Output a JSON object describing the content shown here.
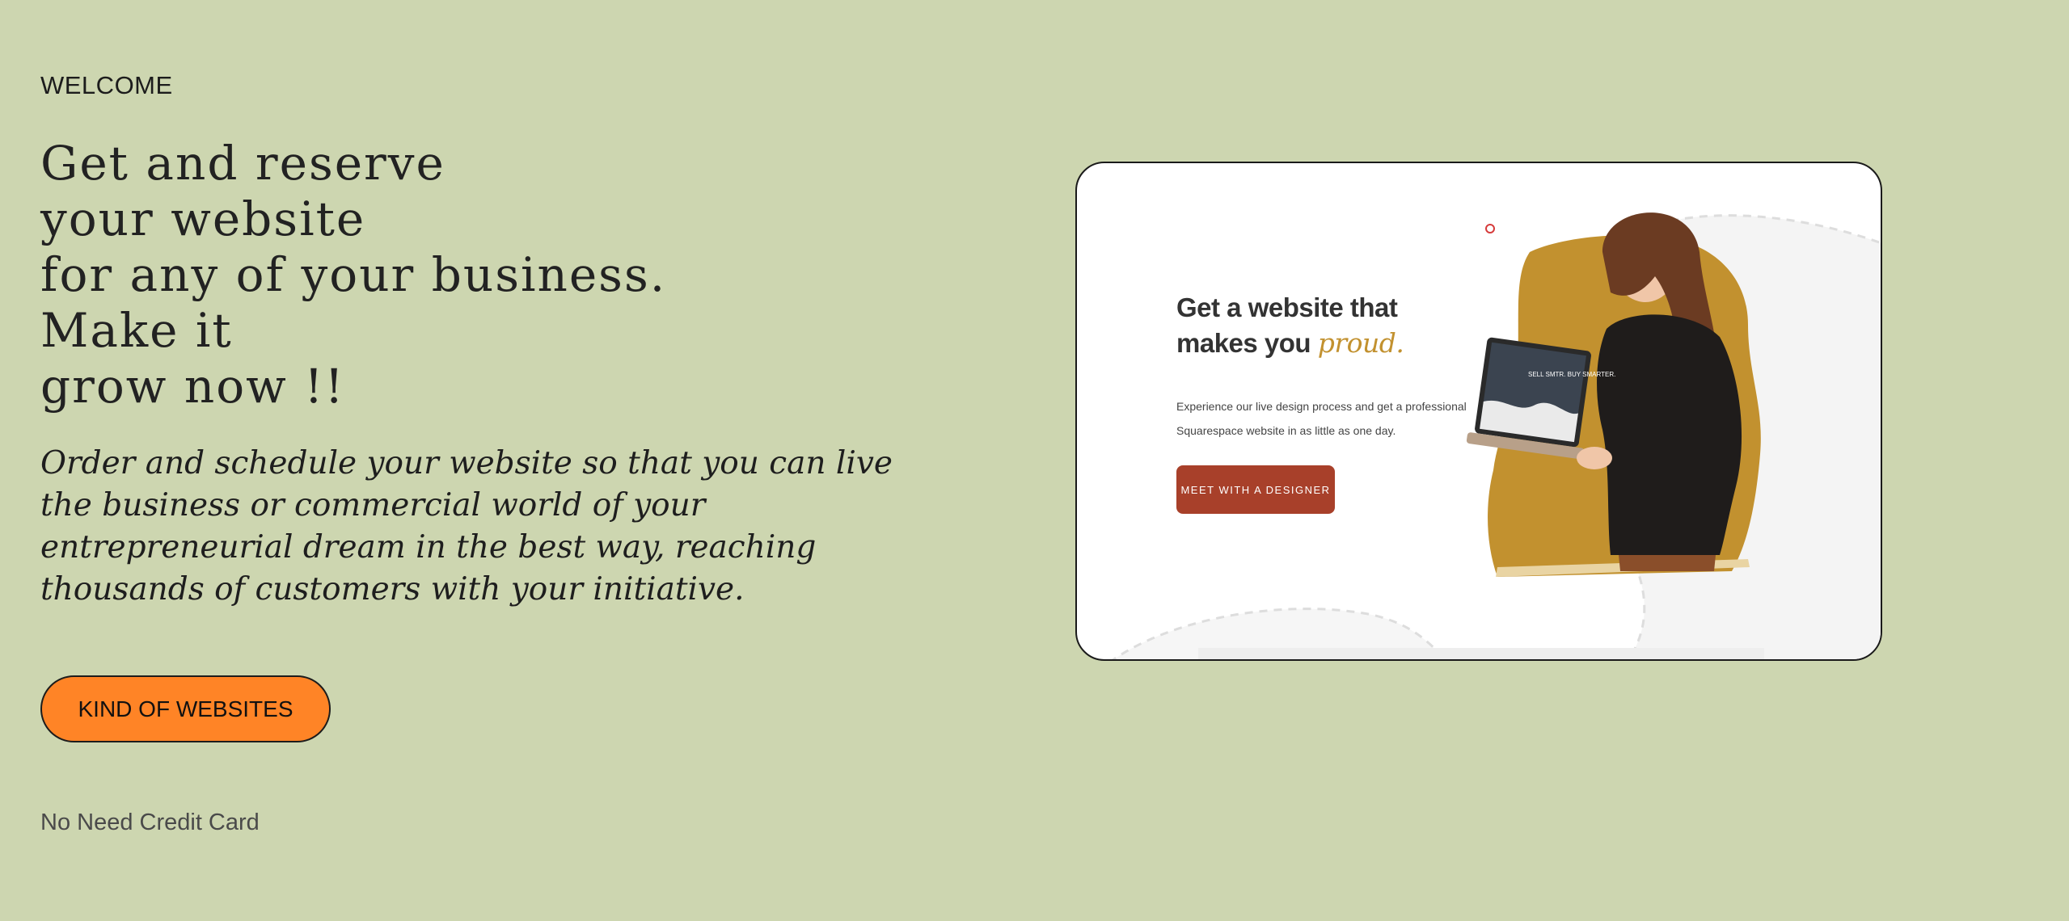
{
  "hero": {
    "eyebrow": "WELCOME",
    "headline_lines": [
      "Get and reserve",
      "your website",
      "for any of your business.",
      "Make it",
      "grow now !!"
    ],
    "lead": "Order and schedule your website so that you can live the business or commercial world of your entrepreneurial dream in the best way, reaching thousands of customers with your initiative.",
    "cta_label": "KIND OF WEBSITES",
    "note": "No Need Credit Card"
  },
  "preview": {
    "title_line1": "Get a website that",
    "title_line2_prefix": "makes you ",
    "title_line2_accent": "proud.",
    "description": "Experience our live design process and get a professional Squarespace website in as little as one day.",
    "button_label": "MEET WITH A DESIGNER",
    "laptop_screen_text": "SELL SMTR. BUY SMARTER.",
    "accent_color": "#c2912f",
    "button_color": "#a8402a"
  },
  "colors": {
    "background": "#cdd6b0",
    "cta": "#ff8426"
  }
}
